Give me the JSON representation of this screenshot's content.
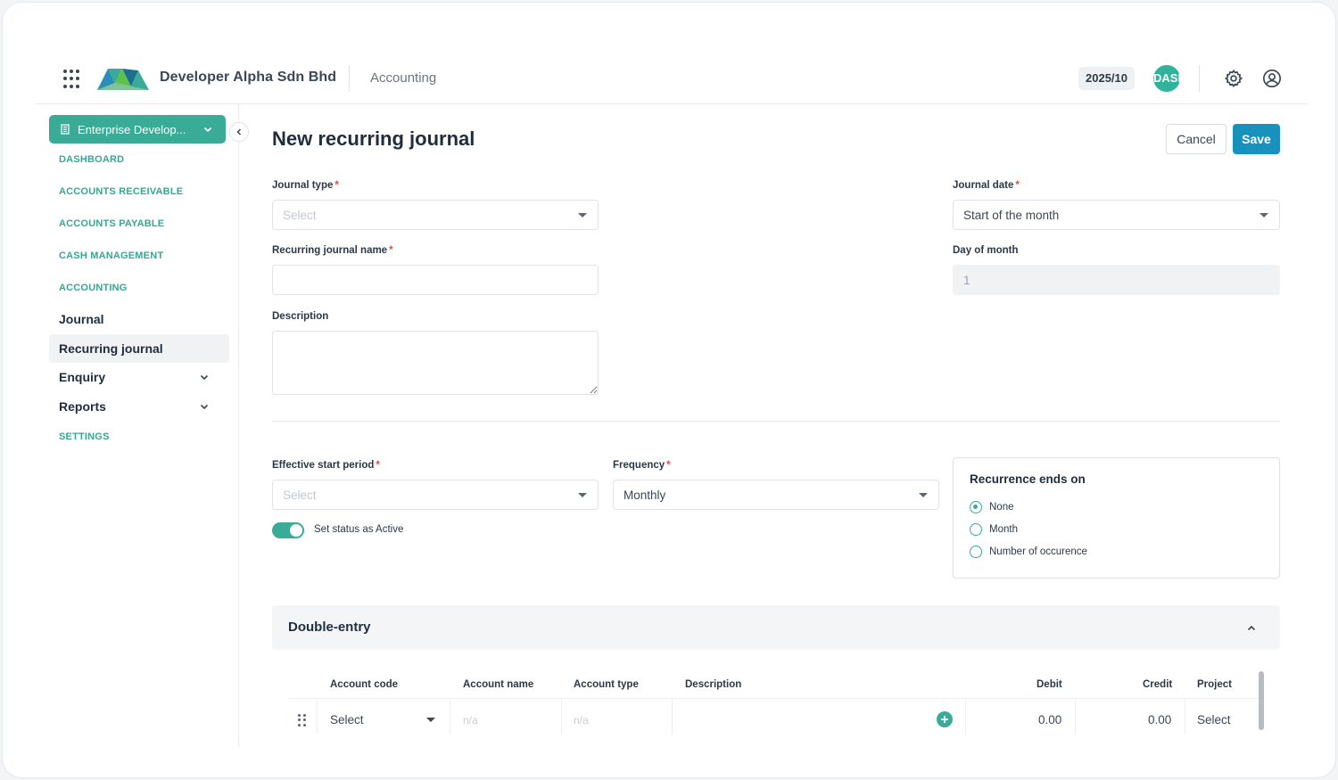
{
  "header": {
    "company": "Developer Alpha Sdn Bhd",
    "module": "Accounting",
    "period": "2025/10",
    "avatar_initials": "DASB",
    "icons": {
      "apps": "apps-grid-icon",
      "settings": "gear-icon",
      "profile": "user-circle-icon"
    }
  },
  "sidebar": {
    "org_selector": "Enterprise Develop...",
    "sections": [
      "DASHBOARD",
      "ACCOUNTS RECEIVABLE",
      "ACCOUNTS PAYABLE",
      "CASH MANAGEMENT",
      "ACCOUNTING"
    ],
    "items": [
      {
        "label": "Journal",
        "active": false
      },
      {
        "label": "Recurring journal",
        "active": true
      },
      {
        "label": "Enquiry",
        "expandable": true
      },
      {
        "label": "Reports",
        "expandable": true
      }
    ],
    "settings": "SETTINGS"
  },
  "page": {
    "title": "New recurring journal",
    "cancel": "Cancel",
    "save": "Save"
  },
  "form": {
    "journal_type": {
      "label": "Journal type",
      "placeholder": "Select"
    },
    "journal_name": {
      "label": "Recurring journal name",
      "value": ""
    },
    "description": {
      "label": "Description",
      "value": ""
    },
    "journal_date": {
      "label": "Journal date",
      "value": "Start of the month"
    },
    "day_of_month": {
      "label": "Day of month",
      "value": "1"
    },
    "effective_start": {
      "label": "Effective start period",
      "placeholder": "Select"
    },
    "frequency": {
      "label": "Frequency",
      "value": "Monthly"
    },
    "status_toggle": {
      "label": "Set status as Active",
      "on": true
    },
    "recurrence": {
      "title": "Recurrence ends on",
      "options": [
        "None",
        "Month",
        "Number of occurence"
      ],
      "selected": "None"
    }
  },
  "double_entry": {
    "title": "Double-entry",
    "columns": [
      "Account code",
      "Account name",
      "Account type",
      "Description",
      "Debit",
      "Credit",
      "Project"
    ],
    "row": {
      "account_code": "Select",
      "account_name": "n/a",
      "account_type": "n/a",
      "debit": "0.00",
      "credit": "0.00",
      "project": "Select"
    }
  },
  "colors": {
    "brand_teal": "#3aab97",
    "primary_blue": "#1891bd",
    "required": "#e5484d"
  }
}
